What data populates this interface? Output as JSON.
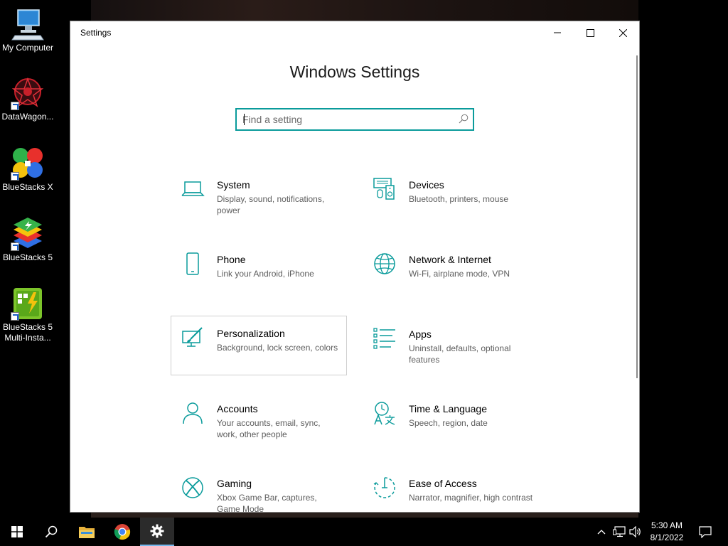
{
  "desktop": {
    "icons": [
      {
        "label": "My Computer"
      },
      {
        "label": "DataWagon..."
      },
      {
        "label": "BlueStacks X"
      },
      {
        "label": "BlueStacks 5"
      },
      {
        "label_line1": "BlueStacks 5",
        "label_line2": "Multi-Insta..."
      }
    ]
  },
  "window": {
    "title": "Settings",
    "heading": "Windows Settings",
    "search": {
      "placeholder": "Find a setting",
      "value": ""
    }
  },
  "categories": [
    {
      "title": "System",
      "desc": "Display, sound, notifications, power",
      "icon": "laptop-icon"
    },
    {
      "title": "Devices",
      "desc": "Bluetooth, printers, mouse",
      "icon": "devices-icon"
    },
    {
      "title": "Phone",
      "desc": "Link your Android, iPhone",
      "icon": "phone-icon"
    },
    {
      "title": "Network & Internet",
      "desc": "Wi-Fi, airplane mode, VPN",
      "icon": "globe-icon"
    },
    {
      "title": "Personalization",
      "desc": "Background, lock screen, colors",
      "icon": "paintbrush-icon"
    },
    {
      "title": "Apps",
      "desc": "Uninstall, defaults, optional features",
      "icon": "apps-list-icon"
    },
    {
      "title": "Accounts",
      "desc": "Your accounts, email, sync, work, other people",
      "icon": "person-icon"
    },
    {
      "title": "Time & Language",
      "desc": "Speech, region, date",
      "icon": "time-language-icon"
    },
    {
      "title": "Gaming",
      "desc": "Xbox Game Bar, captures, Game Mode",
      "icon": "xbox-icon"
    },
    {
      "title": "Ease of Access",
      "desc": "Narrator, magnifier, high contrast",
      "icon": "ease-of-access-icon"
    }
  ],
  "taskbar": {
    "time": "5:30 AM",
    "date": "8/1/2022"
  },
  "colors": {
    "accent": "#0a9b9b",
    "taskbar_bg": "#000000",
    "active_task_indicator": "#76b9ed"
  }
}
